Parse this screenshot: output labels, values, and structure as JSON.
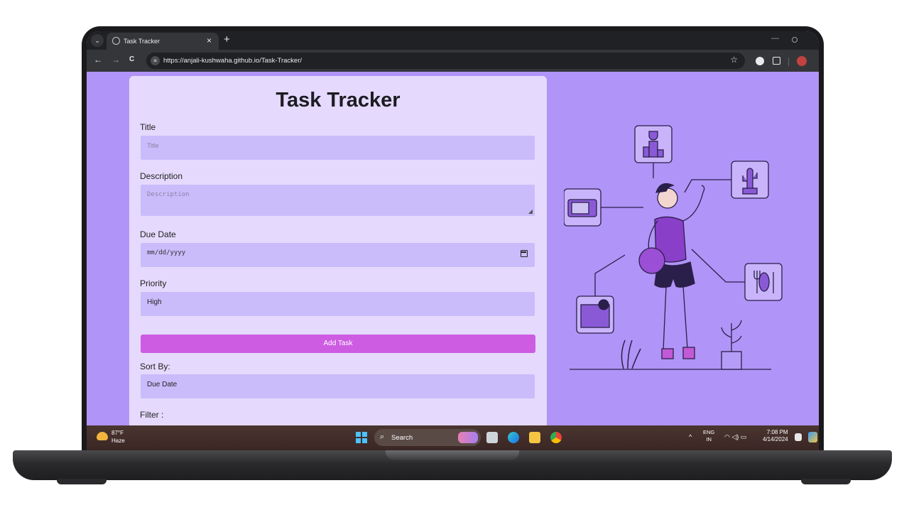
{
  "browser": {
    "tab_title": "Task Tracker",
    "tab_close": "×",
    "new_tab": "+",
    "menu_glyph": "⌄",
    "back": "←",
    "forward": "→",
    "reload": "C",
    "url": "https://anjali-kushwaha.github.io/Task-Tracker/",
    "star": "☆",
    "window_min": "—"
  },
  "app": {
    "title": "Task Tracker",
    "fields": {
      "title_label": "Title",
      "title_placeholder": "Title",
      "description_label": "Description",
      "description_placeholder": "Description",
      "due_date_label": "Due Date",
      "due_date_placeholder": "mm/dd/yyyy",
      "priority_label": "Priority",
      "priority_value": "High",
      "sort_label": "Sort By:",
      "sort_value": "Due Date",
      "filter_label": "Filter :"
    },
    "add_button": "Add Task",
    "accent_color": "#cd5ce2",
    "background_color": "#b194f7"
  },
  "taskbar": {
    "weather_temp": "87°F",
    "weather_desc": "Haze",
    "search_label": "Search",
    "search_glyph": "⌕",
    "lang_line1": "ENG",
    "lang_line2": "IN",
    "time": "7:08 PM",
    "date": "4/14/2024",
    "chevron": "^",
    "tray_glyphs": "◠ ◁) ▭"
  },
  "icons": [
    "search-icon",
    "calendar-icon",
    "windows-icon",
    "star-icon",
    "reload-icon",
    "back-icon",
    "forward-icon",
    "close-icon"
  ]
}
